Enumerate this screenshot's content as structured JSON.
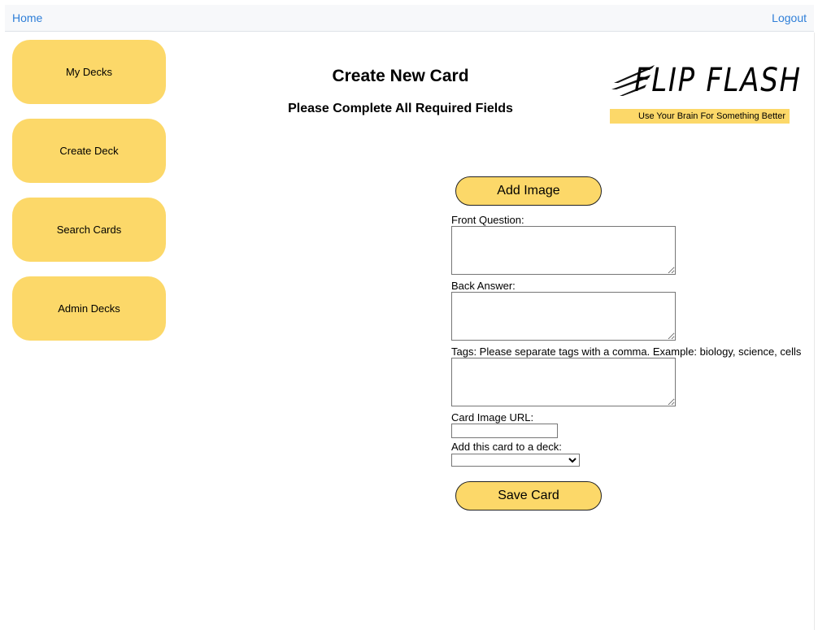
{
  "nav": {
    "home": "Home",
    "logout": "Logout"
  },
  "sidebar": {
    "items": [
      {
        "label": "My Decks"
      },
      {
        "label": "Create Deck"
      },
      {
        "label": "Search Cards"
      },
      {
        "label": "Admin Decks"
      }
    ]
  },
  "header": {
    "title": "Create New Card",
    "subtitle": "Please Complete All Required Fields"
  },
  "logo": {
    "text": "FLIP FLASH",
    "tagline": "Use Your Brain For Something Better"
  },
  "form": {
    "add_image_label": "Add Image",
    "front_label": "Front Question:",
    "front_value": "",
    "back_label": "Back Answer:",
    "back_value": "",
    "tags_label": "Tags: Please separate tags with a comma. Example: biology, science, cells",
    "tags_value": "",
    "url_label": "Card Image URL:",
    "url_value": "",
    "deck_label": "Add this card to a deck:",
    "deck_selected": "",
    "save_label": "Save Card"
  },
  "colors": {
    "accent": "#fcd869",
    "link": "#2f7fd8"
  }
}
